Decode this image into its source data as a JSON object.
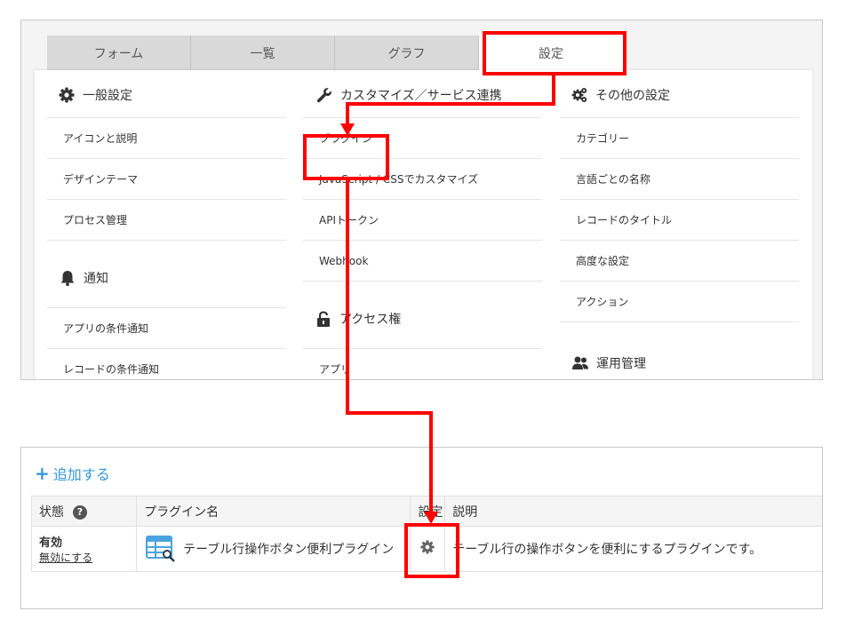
{
  "tabs": [
    {
      "label": "フォーム"
    },
    {
      "label": "一覧"
    },
    {
      "label": "グラフ"
    },
    {
      "label": "設定"
    }
  ],
  "general": {
    "title": "一般設定",
    "icon": "gear-icon",
    "items": [
      "アイコンと説明",
      "デザインテーマ",
      "プロセス管理"
    ]
  },
  "notify": {
    "title": "通知",
    "icon": "bell-icon",
    "items": [
      "アプリの条件通知",
      "レコードの条件通知"
    ]
  },
  "customize": {
    "title": "カスタマイズ／サービス連携",
    "icon": "wrench-icon",
    "items": [
      "プラグイン",
      "JavaScript / CSSでカスタマイズ",
      "APIトークン",
      "Webhook"
    ]
  },
  "access": {
    "title": "アクセス権",
    "icon": "lock-icon",
    "items": [
      "アプリ"
    ]
  },
  "other": {
    "title": "その他の設定",
    "icon": "gears-icon",
    "items": [
      "カテゴリー",
      "言語ごとの名称",
      "レコードのタイトル",
      "高度な設定",
      "アクション"
    ]
  },
  "operation": {
    "title": "運用管理",
    "icon": "people-icon"
  },
  "plugin_panel": {
    "add_label": "追加する",
    "columns": {
      "status": "状態",
      "name": "プラグイン名",
      "settings": "設定",
      "description": "説明"
    },
    "rows": [
      {
        "status": "有効",
        "toggle_label": "無効にする",
        "name": "テーブル行操作ボタン便利プラグイン",
        "description": "テーブル行の操作ボタンを便利にするプラグインです。"
      }
    ]
  },
  "colors": {
    "accent": "#3498db",
    "highlight": "#ff0000"
  }
}
